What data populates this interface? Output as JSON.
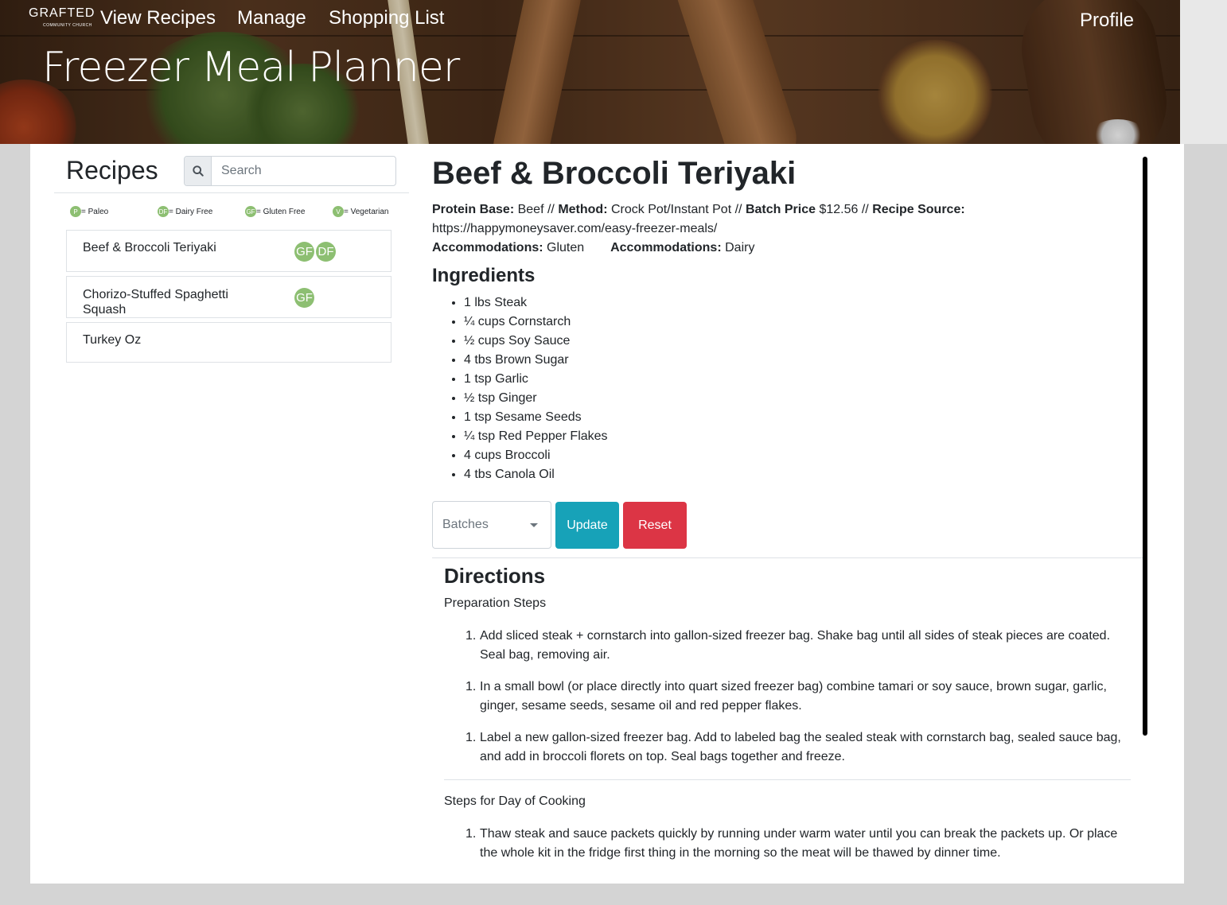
{
  "header": {
    "logo": {
      "word": "GRAFTED",
      "subtitle": "COMMUNITY CHURCH"
    },
    "nav": [
      "View Recipes",
      "Manage",
      "Shopping List"
    ],
    "profile": "Profile",
    "title": "Freezer Meal Planner"
  },
  "sidebar": {
    "title": "Recipes",
    "search": {
      "placeholder": "Search",
      "value": ""
    },
    "legend": [
      {
        "badge": "P",
        "label": "= Paleo"
      },
      {
        "badge": "DF",
        "label": "= Dairy Free"
      },
      {
        "badge": "GF",
        "label": "= Gluten Free"
      },
      {
        "badge": "V",
        "label": "= Vegetarian"
      }
    ],
    "recipes": [
      {
        "name": "Beef & Broccoli Teriyaki",
        "badges": [
          "GF",
          "DF"
        ]
      },
      {
        "name": "Chorizo-Stuffed Spaghetti Squash",
        "badges": [
          "GF"
        ]
      },
      {
        "name": "Turkey Oz",
        "badges": []
      }
    ]
  },
  "recipe": {
    "title": "Beef & Broccoli Teriyaki",
    "protein_label": "Protein Base:",
    "protein": "Beef",
    "method_label": "Method:",
    "method": "Crock Pot/Instant Pot",
    "price_label": "Batch Price",
    "price": "$12.56",
    "source_label": "Recipe Source:",
    "source": "https://happymoneysaver.com/easy-freezer-meals/",
    "separator": "//",
    "accommodations": [
      {
        "label": "Accommodations:",
        "value": "Gluten"
      },
      {
        "label": "Accommodations:",
        "value": "Dairy"
      }
    ],
    "ingredients_title": "Ingredients",
    "ingredients": [
      "1 lbs Steak",
      "¼ cups Cornstarch",
      "½ cups Soy Sauce",
      "4 tbs Brown Sugar",
      "1 tsp Garlic",
      "½ tsp Ginger",
      "1 tsp Sesame Seeds",
      "¼ tsp Red Pepper Flakes",
      "4 cups Broccoli",
      "4 tbs Canola Oil"
    ],
    "batches_placeholder": "Batches",
    "update_label": "Update",
    "reset_label": "Reset",
    "directions_title": "Directions",
    "prep_title": "Preparation Steps",
    "prep_steps": [
      "Add sliced steak + cornstarch into gallon-sized freezer bag. Shake bag until all sides of steak pieces are coated. Seal bag, removing air.",
      "In a small bowl (or place directly into quart sized freezer bag) combine tamari or soy sauce, brown sugar, garlic, ginger, sesame seeds, sesame oil and red pepper flakes.",
      "Label a new gallon-sized freezer bag. Add to labeled bag the sealed steak with cornstarch bag, sealed sauce bag, and add in broccoli florets on top. Seal bags together and freeze."
    ],
    "cook_title": "Steps for Day of Cooking",
    "cook_steps": [
      "Thaw steak and sauce packets quickly by running under warm water until you can break the packets up. Or place the whole kit in the fridge first thing in the morning so the meat will be thawed by dinner time."
    ],
    "step_number": "1."
  },
  "colors": {
    "badge": "#8dbf72",
    "update": "#17a2b8",
    "reset": "#dc3545",
    "page_bg": "#d4d4d4"
  }
}
